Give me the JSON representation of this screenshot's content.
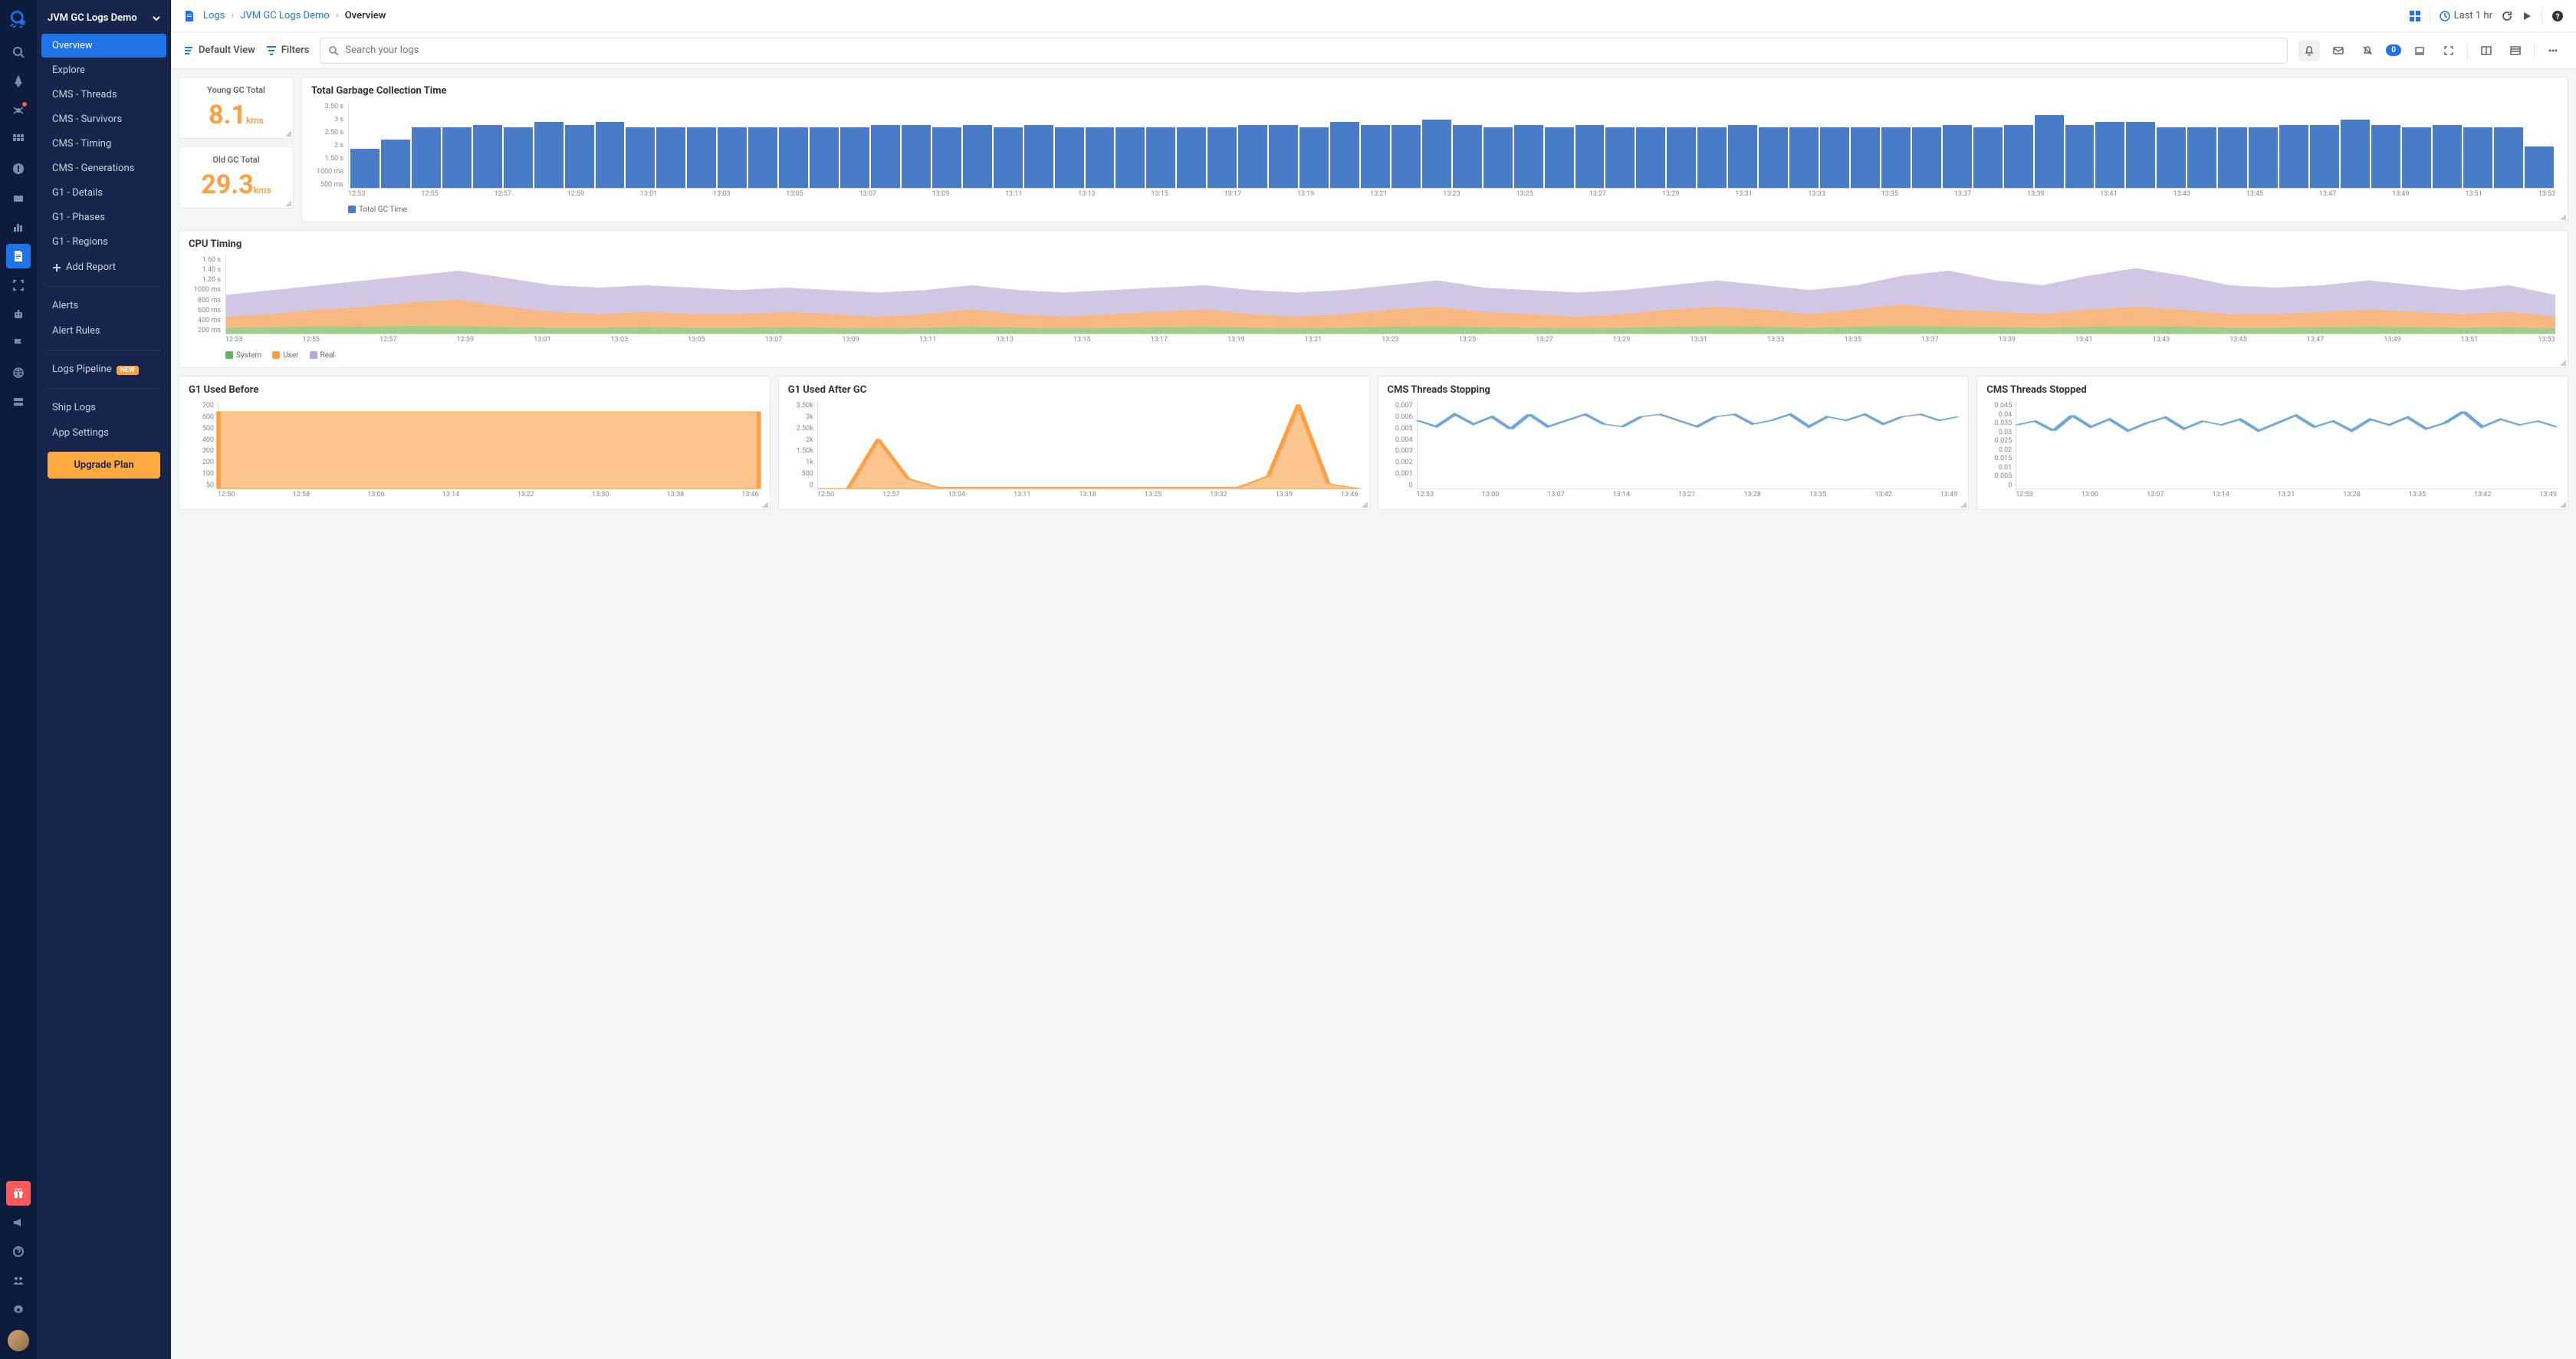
{
  "app_title": "JVM GC Logs Demo",
  "breadcrumbs": {
    "root": "Logs",
    "mid": "JVM GC Logs Demo",
    "current": "Overview"
  },
  "timerange": "Last 1 hr",
  "toolbar": {
    "default_view": "Default View",
    "filters": "Filters",
    "search_placeholder": "Search your logs",
    "alert_count": "0"
  },
  "sidebar": {
    "items": [
      "Overview",
      "Explore",
      "CMS - Threads",
      "CMS - Survivors",
      "CMS - Timing",
      "CMS - Generations",
      "G1 - Details",
      "G1 - Phases",
      "G1 - Regions"
    ],
    "add_report": "Add Report",
    "sections": {
      "alerts": "Alerts",
      "alert_rules": "Alert Rules",
      "logs_pipeline": "Logs Pipeline",
      "new_badge": "NEW",
      "ship_logs": "Ship Logs",
      "app_settings": "App Settings"
    },
    "upgrade": "Upgrade Plan"
  },
  "stats": {
    "young": {
      "label": "Young GC Total",
      "value": "8.1",
      "unit": "kms"
    },
    "old": {
      "label": "Old GC Total",
      "value": "29.3",
      "unit": "kms"
    }
  },
  "chart_data": [
    {
      "id": "total_gc",
      "type": "bar",
      "title": "Total Garbage Collection Time",
      "legend": [
        "Total GC Time"
      ],
      "colors": [
        "#4a7bc8"
      ],
      "ylabel": "",
      "ylim": [
        0,
        3.5
      ],
      "y_ticks": [
        "3.50 s",
        "3 s",
        "2.50 s",
        "2 s",
        "1.50 s",
        "1000 ms",
        "500 ms"
      ],
      "x_ticks": [
        "12:53",
        "12:55",
        "12:57",
        "12:59",
        "13:01",
        "13:03",
        "13:05",
        "13:07",
        "13:09",
        "13:11",
        "13:13",
        "13:15",
        "13:17",
        "13:19",
        "13:21",
        "13:23",
        "13:25",
        "13:27",
        "13:29",
        "13:31",
        "13:33",
        "13:35",
        "13:37",
        "13:39",
        "13:41",
        "13:43",
        "13:45",
        "13:47",
        "13:49",
        "13:51",
        "13:53"
      ],
      "values": [
        1.6,
        2.0,
        2.5,
        2.5,
        2.6,
        2.5,
        2.7,
        2.6,
        2.7,
        2.5,
        2.5,
        2.5,
        2.5,
        2.5,
        2.5,
        2.5,
        2.5,
        2.6,
        2.6,
        2.5,
        2.6,
        2.5,
        2.6,
        2.5,
        2.5,
        2.5,
        2.5,
        2.5,
        2.5,
        2.6,
        2.6,
        2.5,
        2.7,
        2.6,
        2.6,
        2.8,
        2.6,
        2.5,
        2.6,
        2.5,
        2.6,
        2.5,
        2.5,
        2.5,
        2.5,
        2.6,
        2.5,
        2.5,
        2.5,
        2.5,
        2.5,
        2.5,
        2.6,
        2.5,
        2.6,
        3.0,
        2.6,
        2.7,
        2.7,
        2.5,
        2.5,
        2.5,
        2.5,
        2.6,
        2.6,
        2.8,
        2.6,
        2.5,
        2.6,
        2.5,
        2.5,
        1.7
      ]
    },
    {
      "id": "cpu_timing",
      "type": "area",
      "title": "CPU Timing",
      "legend": [
        "System",
        "User",
        "Real"
      ],
      "colors": [
        "#5cb85c",
        "#ff9f43",
        "#b8a8d9"
      ],
      "ylim": [
        0,
        1.6
      ],
      "y_ticks": [
        "1.60 s",
        "1.40 s",
        "1.20 s",
        "1000 ms",
        "800 ms",
        "600 ms",
        "400 ms",
        "200 ms"
      ],
      "x_ticks": [
        "12:53",
        "12:55",
        "12:57",
        "12:59",
        "13:01",
        "13:03",
        "13:05",
        "13:07",
        "13:09",
        "13:11",
        "13:13",
        "13:15",
        "13:17",
        "13:19",
        "13:21",
        "13:23",
        "13:25",
        "13:27",
        "13:29",
        "13:31",
        "13:33",
        "13:35",
        "13:37",
        "13:39",
        "13:41",
        "13:43",
        "13:45",
        "13:47",
        "13:49",
        "13:51",
        "13:53"
      ],
      "series": [
        {
          "name": "Real",
          "values": [
            0.8,
            0.9,
            1.0,
            1.1,
            1.2,
            1.3,
            1.15,
            1.0,
            0.95,
            1.0,
            0.95,
            0.9,
            0.95,
            0.9,
            0.85,
            0.9,
            1.0,
            0.9,
            0.85,
            0.9,
            0.95,
            1.0,
            0.9,
            0.85,
            0.9,
            1.0,
            1.1,
            0.95,
            0.9,
            0.85,
            0.9,
            1.0,
            1.1,
            1.0,
            0.9,
            1.0,
            1.2,
            1.3,
            1.1,
            1.0,
            1.2,
            1.35,
            1.2,
            1.0,
            0.95,
            1.0,
            1.1,
            1.0,
            0.9,
            1.0,
            0.8
          ]
        },
        {
          "name": "User",
          "values": [
            0.35,
            0.4,
            0.5,
            0.55,
            0.65,
            0.7,
            0.55,
            0.45,
            0.4,
            0.45,
            0.4,
            0.4,
            0.45,
            0.4,
            0.35,
            0.4,
            0.5,
            0.4,
            0.35,
            0.4,
            0.45,
            0.5,
            0.4,
            0.35,
            0.4,
            0.5,
            0.55,
            0.45,
            0.4,
            0.35,
            0.4,
            0.5,
            0.55,
            0.5,
            0.4,
            0.5,
            0.6,
            0.5,
            0.45,
            0.4,
            0.5,
            0.55,
            0.5,
            0.4,
            0.4,
            0.45,
            0.5,
            0.45,
            0.4,
            0.45,
            0.35
          ]
        },
        {
          "name": "System",
          "values": [
            0.12,
            0.13,
            0.15,
            0.14,
            0.16,
            0.15,
            0.13,
            0.12,
            0.12,
            0.13,
            0.12,
            0.12,
            0.13,
            0.12,
            0.11,
            0.12,
            0.14,
            0.12,
            0.11,
            0.12,
            0.13,
            0.14,
            0.12,
            0.11,
            0.12,
            0.14,
            0.15,
            0.13,
            0.12,
            0.11,
            0.12,
            0.14,
            0.15,
            0.14,
            0.12,
            0.14,
            0.16,
            0.14,
            0.13,
            0.12,
            0.14,
            0.15,
            0.14,
            0.12,
            0.12,
            0.13,
            0.14,
            0.13,
            0.12,
            0.13,
            0.11
          ]
        }
      ]
    },
    {
      "id": "g1_before",
      "type": "area",
      "title": "G1 Used Before",
      "colors": [
        "#ff9f43"
      ],
      "ylim": [
        0,
        700
      ],
      "y_ticks": [
        "700",
        "600",
        "500",
        "400",
        "300",
        "200",
        "100",
        "50"
      ],
      "x_ticks": [
        "12:50",
        "12:58",
        "13:06",
        "13:14",
        "13:22",
        "13:30",
        "13:38",
        "13:46"
      ],
      "values": [
        620,
        620,
        620,
        620,
        620,
        620,
        620,
        620,
        620,
        620,
        620,
        620,
        620,
        620,
        620,
        620,
        620,
        620,
        620,
        620
      ]
    },
    {
      "id": "g1_after",
      "type": "area",
      "title": "G1 Used After GC",
      "colors": [
        "#ff9f43"
      ],
      "ylim": [
        0,
        3500
      ],
      "y_ticks": [
        "3.50k",
        "3k",
        "2.50k",
        "2k",
        "1.50k",
        "1k",
        "500",
        "0"
      ],
      "x_ticks": [
        "12:50",
        "12:57",
        "13:04",
        "13:11",
        "13:18",
        "13:25",
        "13:32",
        "13:39",
        "13:46"
      ],
      "values": [
        0,
        0,
        2000,
        400,
        50,
        50,
        50,
        50,
        50,
        50,
        50,
        50,
        50,
        50,
        50,
        500,
        3400,
        200,
        0
      ]
    },
    {
      "id": "cms_stopping",
      "type": "line",
      "title": "CMS Threads Stopping",
      "colors": [
        "#6fa8d8"
      ],
      "ylim": [
        0,
        0.007
      ],
      "y_ticks": [
        "0.007",
        "0.006",
        "0.005",
        "0.004",
        "0.003",
        "0.002",
        "0.001",
        "0"
      ],
      "x_ticks": [
        "12:53",
        "13:00",
        "13:07",
        "13:14",
        "13:21",
        "13:28",
        "13:35",
        "13:42",
        "13:49"
      ],
      "values": [
        0.0055,
        0.005,
        0.006,
        0.0052,
        0.0058,
        0.0048,
        0.006,
        0.005,
        0.0055,
        0.006,
        0.0052,
        0.005,
        0.0058,
        0.006,
        0.0055,
        0.005,
        0.0058,
        0.006,
        0.0052,
        0.0055,
        0.006,
        0.005,
        0.0058,
        0.0055,
        0.006,
        0.0052,
        0.0058,
        0.006,
        0.0055,
        0.0058
      ]
    },
    {
      "id": "cms_stopped",
      "type": "line",
      "title": "CMS Threads Stopped",
      "colors": [
        "#6fa8d8"
      ],
      "ylim": [
        0,
        0.045
      ],
      "y_ticks": [
        "0.045",
        "0.04",
        "0.035",
        "0.03",
        "0.025",
        "0.02",
        "0.015",
        "0.01",
        "0.005",
        "0"
      ],
      "x_ticks": [
        "12:53",
        "13:00",
        "13:07",
        "13:14",
        "13:21",
        "13:28",
        "13:35",
        "13:42",
        "13:49"
      ],
      "values": [
        0.033,
        0.035,
        0.03,
        0.038,
        0.032,
        0.036,
        0.03,
        0.034,
        0.037,
        0.031,
        0.035,
        0.033,
        0.036,
        0.03,
        0.034,
        0.038,
        0.032,
        0.035,
        0.03,
        0.036,
        0.033,
        0.037,
        0.031,
        0.034,
        0.04,
        0.032,
        0.036,
        0.033,
        0.035,
        0.032
      ]
    }
  ]
}
